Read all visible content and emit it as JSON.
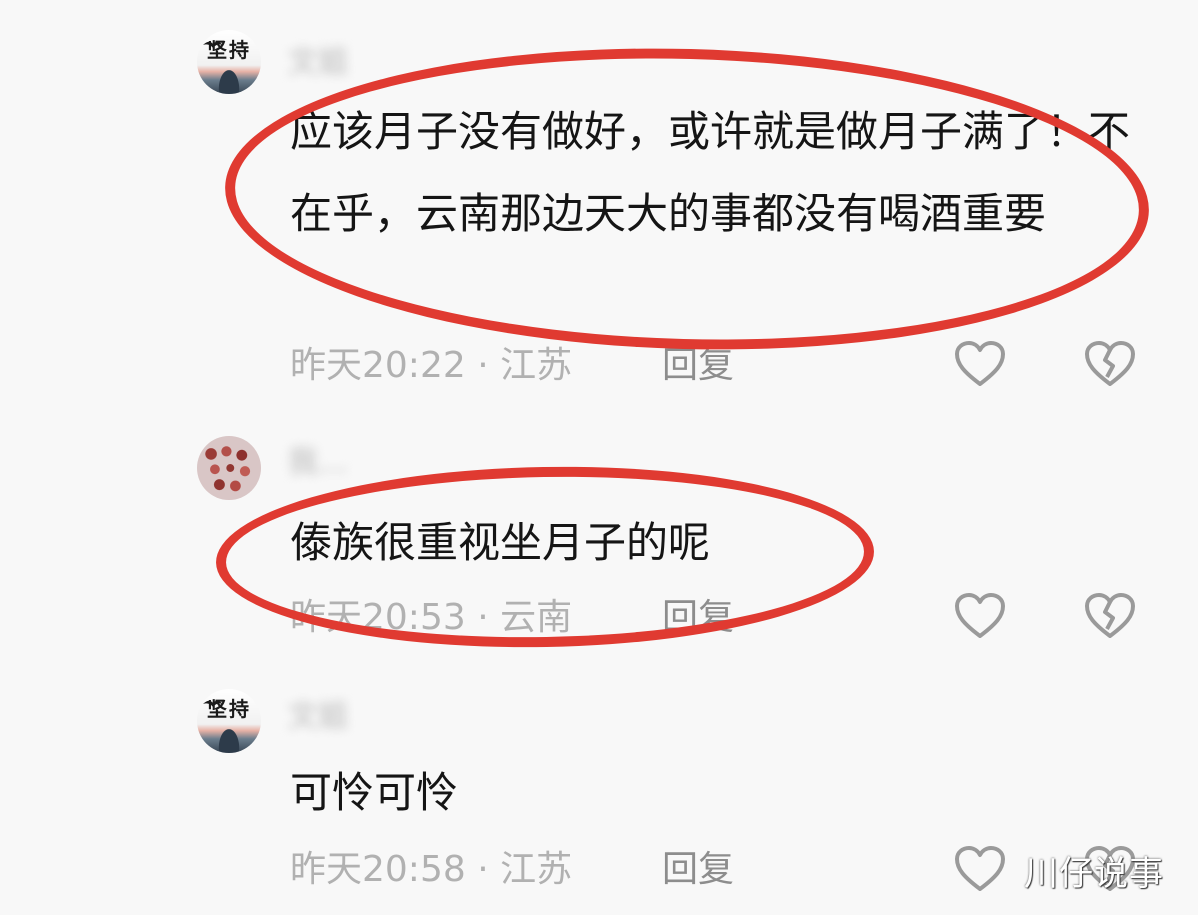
{
  "comments": [
    {
      "username": "文姐",
      "text": "应该月子没有做好，或许就是做月子满了！不在乎，云南那边天大的事都没有喝酒重要",
      "time": "昨天20:22 · 江苏",
      "reply": "回复"
    },
    {
      "username": "我…",
      "text": "傣族很重视坐月子的呢",
      "time": "昨天20:53 · 云南",
      "reply": "回复"
    },
    {
      "username": "文姐",
      "text": "可怜可怜",
      "time": "昨天20:58 · 江苏",
      "reply": "回复"
    }
  ],
  "avatar_glyph": "坚持",
  "watermark": "川仔说事",
  "colors": {
    "annotation": "#e03a31",
    "meta": "#b1b1b1",
    "text": "#151515"
  },
  "icons": {
    "like": "heart-outline-icon",
    "dislike": "broken-heart-icon"
  }
}
